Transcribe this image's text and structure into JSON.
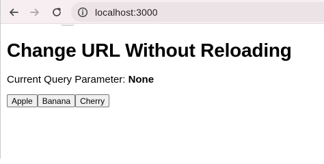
{
  "browser": {
    "url": "localhost:3000",
    "icons": {
      "back": "arrow-left-icon",
      "forward": "arrow-right-icon",
      "reload": "reload-icon",
      "site_info": "site-info-icon"
    }
  },
  "page": {
    "title": "Change URL Without Reloading",
    "param_label": "Current Query Parameter: ",
    "param_value": "None",
    "buttons": [
      {
        "label": "Apple"
      },
      {
        "label": "Banana"
      },
      {
        "label": "Cherry"
      }
    ]
  }
}
